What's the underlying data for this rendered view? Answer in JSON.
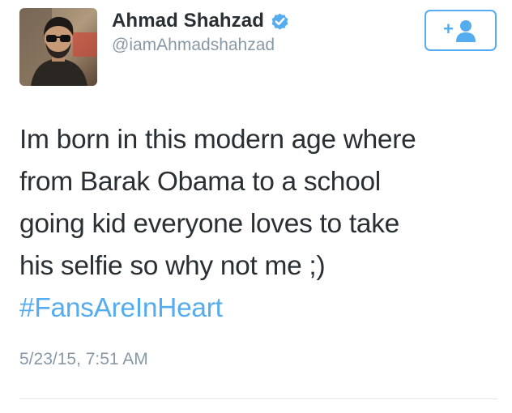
{
  "user": {
    "name": "Ahmad Shahzad",
    "handle": "@iamAhmadshahzad",
    "verified": true,
    "avatar_icon": "profile-photo"
  },
  "follow_button": {
    "icon": "follow-person-icon",
    "glyph": "+"
  },
  "tweet": {
    "lines": [
      "Im born in this modern age where",
      "from Barak Obama to a school",
      "going kid everyone loves to take",
      "his selfie so why not me ;)"
    ],
    "hashtag": "#FansAreInHeart",
    "timestamp": "5/23/15, 7:51 AM"
  },
  "colors": {
    "accent": "#55acee",
    "text": "#292f33",
    "muted": "#8899a6",
    "divider": "#e1e8ed"
  }
}
